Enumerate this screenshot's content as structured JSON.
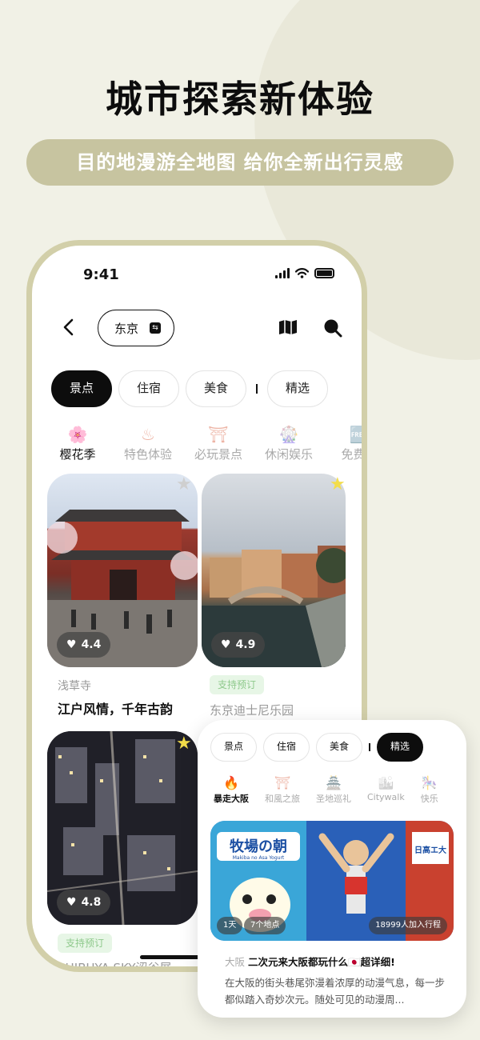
{
  "promo": {
    "headline": "城市探索新体验",
    "subline": "目的地漫游全地图 给你全新出行灵感"
  },
  "status_bar": {
    "time": "9:41"
  },
  "header": {
    "city": "东京"
  },
  "tabs": [
    {
      "label": "景点",
      "active": true
    },
    {
      "label": "住宿",
      "active": false
    },
    {
      "label": "美食",
      "active": false
    },
    {
      "label": "精选",
      "active": false
    }
  ],
  "categories": [
    {
      "label": "樱花季",
      "icon": "sakura-icon",
      "glyph": "🌸",
      "active": true
    },
    {
      "label": "特色体验",
      "icon": "onsen-icon",
      "glyph": "♨",
      "active": false
    },
    {
      "label": "必玩景点",
      "icon": "torii-icon",
      "glyph": "⛩",
      "active": false
    },
    {
      "label": "休闲娱乐",
      "icon": "ferris-wheel-icon",
      "glyph": "🎡",
      "active": false
    },
    {
      "label": "免费游",
      "icon": "free-icon",
      "glyph": "🆓",
      "active": false
    }
  ],
  "cards": [
    {
      "rating": "4.4",
      "sub": "浅草寺",
      "title": "江户风情，千年古韵",
      "star": "grey"
    },
    {
      "rating": "4.9",
      "badge": "支持预订",
      "sub": "东京迪士尼乐园",
      "star": "yellow"
    },
    {
      "rating": "4.8",
      "badge": "支持预订",
      "sub": "SHIBUYA SKY涩谷展",
      "star": "yellow"
    }
  ],
  "overlay": {
    "tabs": [
      {
        "label": "景点",
        "active": false
      },
      {
        "label": "住宿",
        "active": false
      },
      {
        "label": "美食",
        "active": false
      },
      {
        "label": "精选",
        "active": true
      }
    ],
    "categories": [
      {
        "label": "暴走大阪",
        "glyph": "🔥",
        "active": true
      },
      {
        "label": "和風之旅",
        "glyph": "⛩",
        "active": false
      },
      {
        "label": "圣地巡礼",
        "glyph": "🏯",
        "active": false
      },
      {
        "label": "Citywalk",
        "glyph": "🏙",
        "active": false
      },
      {
        "label": "快乐",
        "glyph": "🎠",
        "active": false
      }
    ],
    "meta_days": "1天",
    "meta_places": "7个地点",
    "meta_joined": "18999人加入行程",
    "city": "大阪",
    "title": "二次元来大阪都玩什么🇯🇵超详细!",
    "desc": "在大阪的街头巷尾弥漫着浓厚的动漫气息，每一步都似踏入奇妙次元。随处可见的动漫周...",
    "sign_text": "牧場の朝",
    "sign_sub": "Makiba no Asa Yogurt",
    "shop_text": "日高エ大"
  },
  "colors": {
    "accent": "#c7c4a0",
    "phone_frame": "#d2cfa9",
    "star_yellow": "#f3dd4a",
    "badge_green": "#8fc98c"
  }
}
